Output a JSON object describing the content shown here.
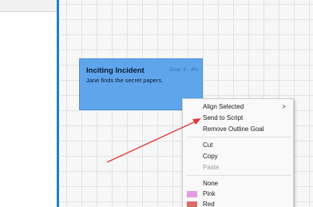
{
  "card": {
    "title": "Inciting Incident",
    "goal_label": "Goal: 4 - 4%",
    "description": "Jane finds the secret papers.",
    "color": "#5fa5ec"
  },
  "context_menu": {
    "items": [
      {
        "label": "Align Selected",
        "submenu": true
      },
      {
        "label": "Send to Script"
      },
      {
        "label": "Remove Outline Goal"
      },
      {
        "label": "Cut"
      },
      {
        "label": "Copy"
      },
      {
        "label": "Paste",
        "disabled": true
      },
      {
        "label": "None"
      },
      {
        "label": "Pink",
        "color": "#e59be6"
      },
      {
        "label": "Red",
        "color": "#e06a6a"
      }
    ],
    "submenu_arrow": ">"
  },
  "annotation": {
    "arrow_color": "#e03a3a"
  }
}
